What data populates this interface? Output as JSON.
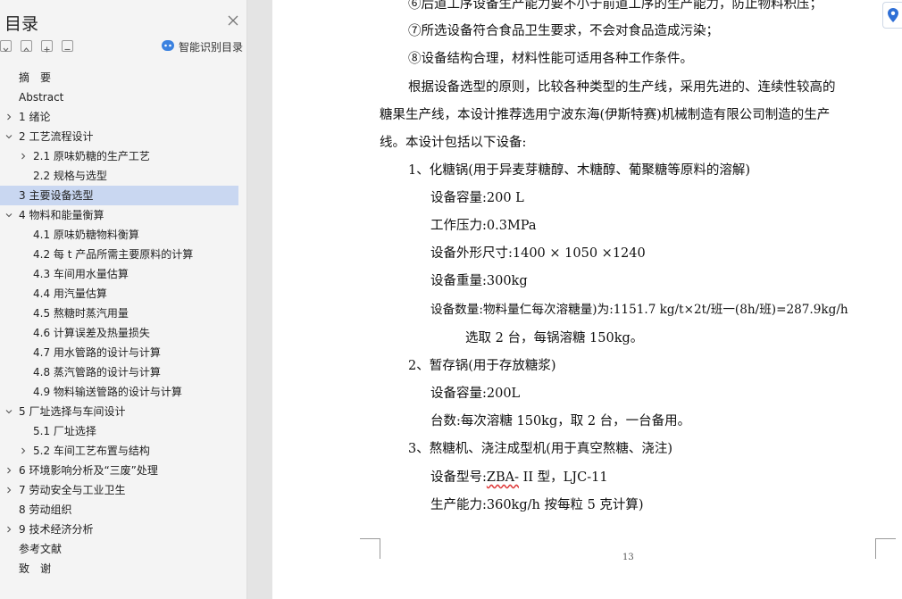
{
  "toc": {
    "title": "目录",
    "smart_label": "智能识别目录",
    "items": [
      {
        "text": "摘　要"
      },
      {
        "text": "Abstract"
      },
      {
        "text": "1 绪论"
      },
      {
        "text": "2 工艺流程设计"
      },
      {
        "text": "2.1  原味奶糖的生产工艺"
      },
      {
        "text": "2.2 规格与选型"
      },
      {
        "text": "3 主要设备选型"
      },
      {
        "text": "4 物料和能量衡算"
      },
      {
        "text": "4.1  原味奶糖物料衡算"
      },
      {
        "text": "4.2  每 t 产品所需主要原料的计算"
      },
      {
        "text": "4.3  车间用水量估算"
      },
      {
        "text": "4.4 用汽量估算"
      },
      {
        "text": "4.5 熬糖时蒸汽用量"
      },
      {
        "text": "4.6 计算误差及热量损失"
      },
      {
        "text": "4.7 用水管路的设计与计算"
      },
      {
        "text": "4.8 蒸汽管路的设计与计算"
      },
      {
        "text": "4.9 物料输送管路的设计与计算"
      },
      {
        "text": "5 厂址选择与车间设计"
      },
      {
        "text": "5.1 厂址选择"
      },
      {
        "text": "5.2 车间工艺布置与结构"
      },
      {
        "text": "6 环境影响分析及“三废”处理"
      },
      {
        "text": "7 劳动安全与工业卫生"
      },
      {
        "text": "8 劳动组织"
      },
      {
        "text": "9 技术经济分析"
      },
      {
        "text": "参考文献"
      },
      {
        "text": "致　谢"
      }
    ]
  },
  "doc": {
    "lines": [
      "⑥后道工序设备生产能力要不小于前道工序的生产能力，防止物料积压；",
      "⑦所选设备符合食品卫生要求，不会对食品造成污染；",
      "⑧设备结构合理，材料性能可适用各种工作条件。",
      "根据设备选型的原则，比较各种类型的生产线，采用先进的、连续性较高的",
      "糖果生产线，本设计推荐选用宁波东海(伊斯特赛)机械制造有限公司制造的生产",
      "线。本设计包括以下设备:",
      "1、化糖锅(用于异麦芽糖醇、木糖醇、葡聚糖等原料的溶解)",
      "设备容量:200 L",
      "工作压力:0.3MPa",
      "设备外形尺寸:1400 × 1050 ×1240",
      "设备重量:300kg",
      "设备数量:物料量仁每次溶糖量)为:1151.7 kg/t×2t/班一(8h/班)=287.9kg/h",
      "选取 2 台，每锅溶糖 150kg。",
      "2、暂存锅(用于存放糖浆)",
      "设备容量:200L",
      "台数:每次溶糖 150kg，取 2 台，一台备用。",
      "3、熬糖机、浇注成型机(用于真空熬糖、浇注)",
      "设备型号:",
      "ZBA-",
      " II 型，LJC-11",
      "生产能力:360kg/h 按每粒 5 克计算)"
    ],
    "page_number": "13"
  }
}
